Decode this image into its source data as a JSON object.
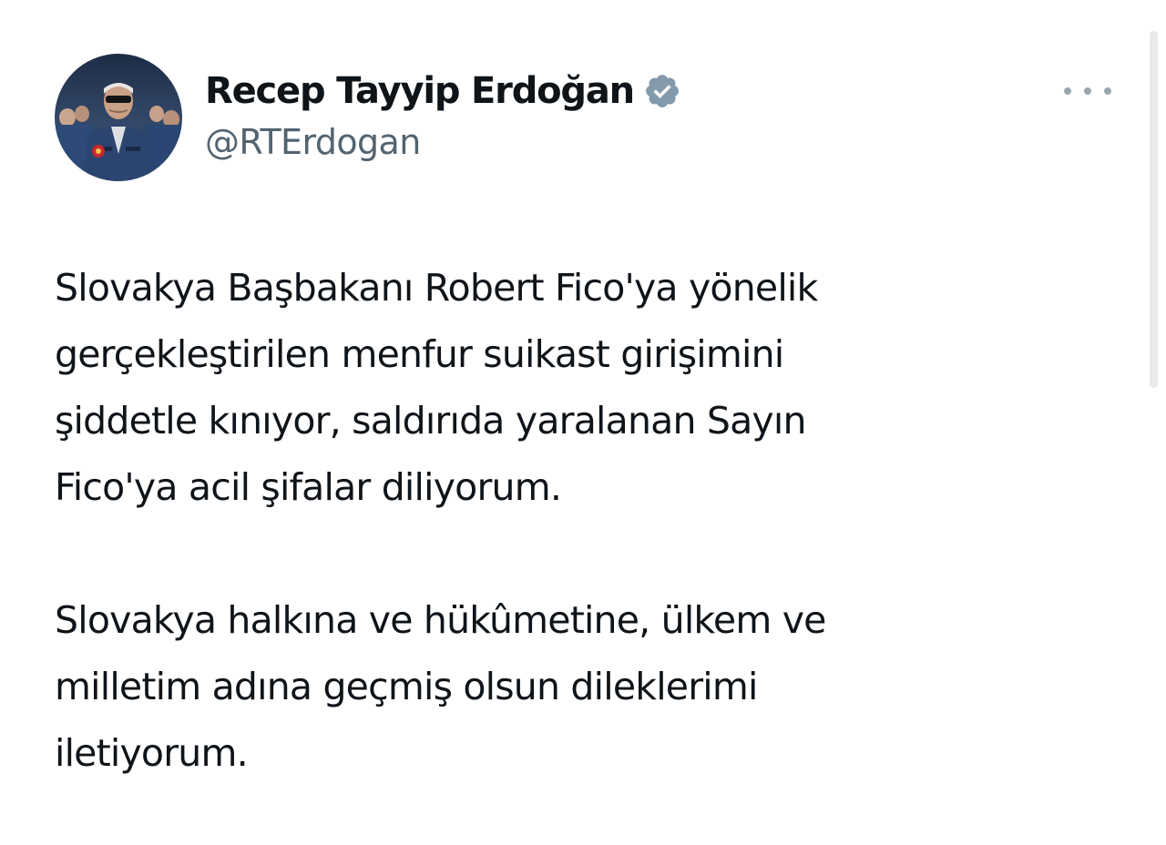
{
  "author": {
    "display_name": "Recep Tayyip Erdoğan",
    "handle": "@RTErdogan",
    "verified_icon": "verified-badge-icon",
    "verified_color": "#829aab"
  },
  "menu": {
    "icon": "more-options-icon"
  },
  "tweet": {
    "paragraphs": [
      {
        "lines": [
          "Slovakya Başbakanı Robert Fico'ya yönelik",
          "gerçekleştirilen menfur suikast girişimini",
          "şiddetle kınıyor, saldırıda yaralanan Sayın",
          "Fico'ya acil şifalar diliyorum."
        ]
      },
      {
        "lines": [
          "Slovakya halkına ve hükûmetine, ülkem ve",
          "milletim adına geçmiş olsun dileklerimi",
          "iletiyorum."
        ]
      }
    ]
  }
}
